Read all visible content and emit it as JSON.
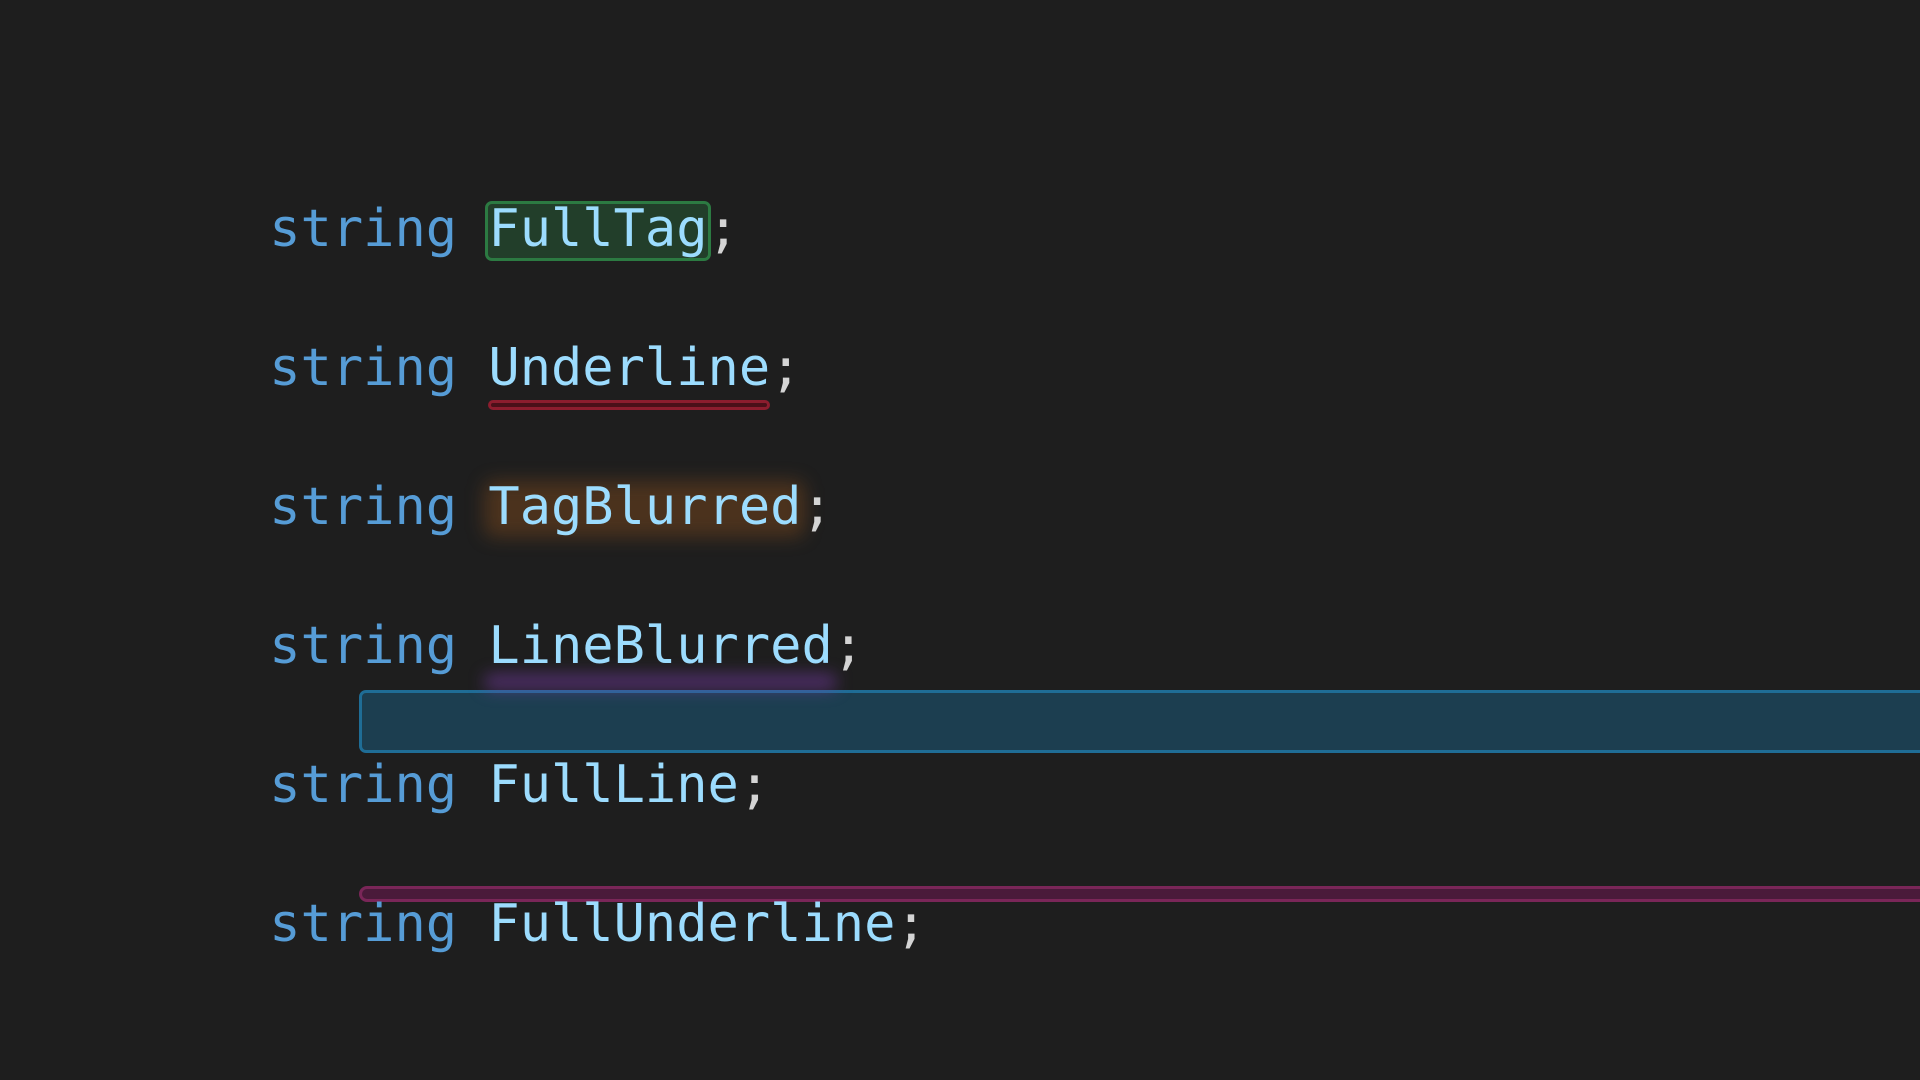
{
  "editor": {
    "lines": [
      {
        "keyword": "string",
        "identifier": "FullTag",
        "terminator": ";"
      },
      {
        "keyword": "string",
        "identifier": "Underline",
        "terminator": ";"
      },
      {
        "keyword": "string",
        "identifier": "TagBlurred",
        "terminator": ";"
      },
      {
        "keyword": "string",
        "identifier": "LineBlurred",
        "terminator": ";"
      },
      {
        "keyword": "string",
        "identifier": "FullLine",
        "terminator": ";"
      },
      {
        "keyword": "string",
        "identifier": "FullUnderline",
        "terminator": ";"
      }
    ]
  },
  "colors": {
    "background": "#1e1e1e",
    "keyword": "#569cd6",
    "identifier": "#9cdcfe",
    "punctuation": "#d4d4d4",
    "full_tag": "#2c7a42",
    "underline": "#8c1d2e",
    "tag_blurred": "#a05a1e",
    "line_blurred": "#783caa",
    "full_line": "#1f6d96",
    "full_underline": "#7a2658"
  }
}
